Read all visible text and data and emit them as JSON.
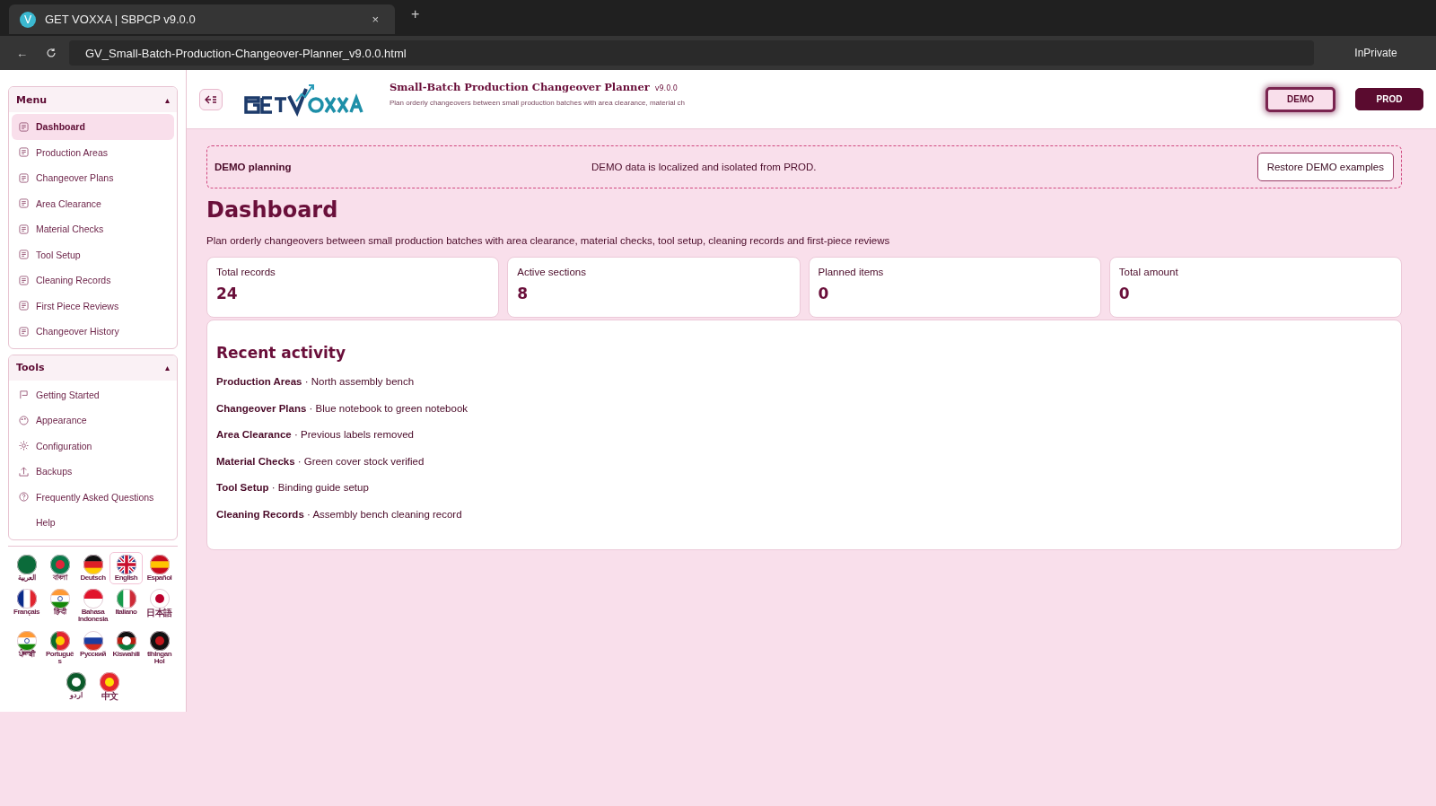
{
  "browser": {
    "tab_title": "GET VOXXA | SBPCP v9.0.0",
    "tab_icon_letter": "V",
    "close": "×",
    "new_tab": "+",
    "back": "←",
    "address": "GV_Small-Batch-Production-Changeover-Planner_v9.0.0.html",
    "profile": "InPrivate"
  },
  "sidebar": {
    "sections": [
      {
        "title": "Menu",
        "caret": "▴",
        "expanded": true,
        "items": [
          {
            "label": "Dashboard",
            "kind": "doc",
            "selected": true
          },
          {
            "label": "Production Areas",
            "kind": "doc",
            "selected": false
          },
          {
            "label": "Changeover Plans",
            "kind": "doc",
            "selected": false
          },
          {
            "label": "Area Clearance",
            "kind": "doc",
            "selected": false
          },
          {
            "label": "Material Checks",
            "kind": "doc",
            "selected": false
          },
          {
            "label": "Tool Setup",
            "kind": "doc",
            "selected": false
          },
          {
            "label": "Cleaning Records",
            "kind": "doc",
            "selected": false
          },
          {
            "label": "First Piece Reviews",
            "kind": "doc",
            "selected": false
          },
          {
            "label": "Changeover History",
            "kind": "doc",
            "selected": false
          }
        ]
      },
      {
        "title": "Tools",
        "caret": "▴",
        "expanded": true,
        "items": [
          {
            "label": "Getting Started",
            "kind": "flag",
            "selected": false
          },
          {
            "label": "Appearance",
            "kind": "palette",
            "selected": false
          },
          {
            "label": "Configuration",
            "kind": "gear",
            "selected": false
          },
          {
            "label": "Backups",
            "kind": "upload",
            "selected": false
          },
          {
            "label": "Frequently Asked Questions",
            "kind": "question",
            "selected": false
          },
          {
            "label": "Help",
            "kind": "none",
            "selected": false
          }
        ]
      }
    ],
    "languages": [
      {
        "label": "العربية",
        "selected": false
      },
      {
        "label": "বাংলা",
        "selected": false
      },
      {
        "label": "Deutsch",
        "selected": false
      },
      {
        "label": "English",
        "selected": true
      },
      {
        "label": "Español",
        "selected": false
      },
      {
        "label": "Français",
        "selected": false
      },
      {
        "label": "हिन्दी",
        "selected": false
      },
      {
        "label": "Bahasa Indonesia",
        "selected": false
      },
      {
        "label": "Italiano",
        "selected": false
      },
      {
        "label": "日本語",
        "selected": false
      },
      {
        "label": "ਪੰਜਾਬੀ",
        "selected": false
      },
      {
        "label": "Português",
        "selected": false
      },
      {
        "label": "Русский",
        "selected": false
      },
      {
        "label": "Kiswahili",
        "selected": false
      },
      {
        "label": "tlhIngan Hol",
        "selected": false
      },
      {
        "label": "اردو",
        "selected": false
      },
      {
        "label": "中文",
        "selected": false
      }
    ]
  },
  "header": {
    "title": "Small-Batch Production Changeover Planner",
    "version": "v9.0.0",
    "subtitle": "Plan orderly changeovers between small production batches with area clearance, material ch",
    "modes": [
      {
        "label": "DEMO",
        "selected": true
      },
      {
        "label": "PROD",
        "selected": false
      }
    ]
  },
  "banner": {
    "title": "DEMO planning",
    "message": "DEMO data is localized and isolated from PROD.",
    "button": "Restore DEMO examples"
  },
  "page": {
    "title": "Dashboard",
    "description": "Plan orderly changeovers between small production batches with area clearance, material checks, tool setup, cleaning records and first-piece reviews"
  },
  "stats": [
    {
      "label": "Total records",
      "value": "24"
    },
    {
      "label": "Active sections",
      "value": "8"
    },
    {
      "label": "Planned items",
      "value": "0"
    },
    {
      "label": "Total amount",
      "value": "0"
    }
  ],
  "recent_activity": {
    "title": "Recent activity",
    "items": [
      {
        "section": "Production Areas",
        "separator": "·",
        "detail": "North assembly bench"
      },
      {
        "section": "Changeover Plans",
        "separator": "·",
        "detail": "Blue notebook to green notebook"
      },
      {
        "section": "Area Clearance",
        "separator": "·",
        "detail": "Previous labels removed"
      },
      {
        "section": "Material Checks",
        "separator": "·",
        "detail": "Green cover stock verified"
      },
      {
        "section": "Tool Setup",
        "separator": "·",
        "detail": "Binding guide setup"
      },
      {
        "section": "Cleaning Records",
        "separator": "·",
        "detail": "Assembly bench cleaning record"
      }
    ]
  }
}
